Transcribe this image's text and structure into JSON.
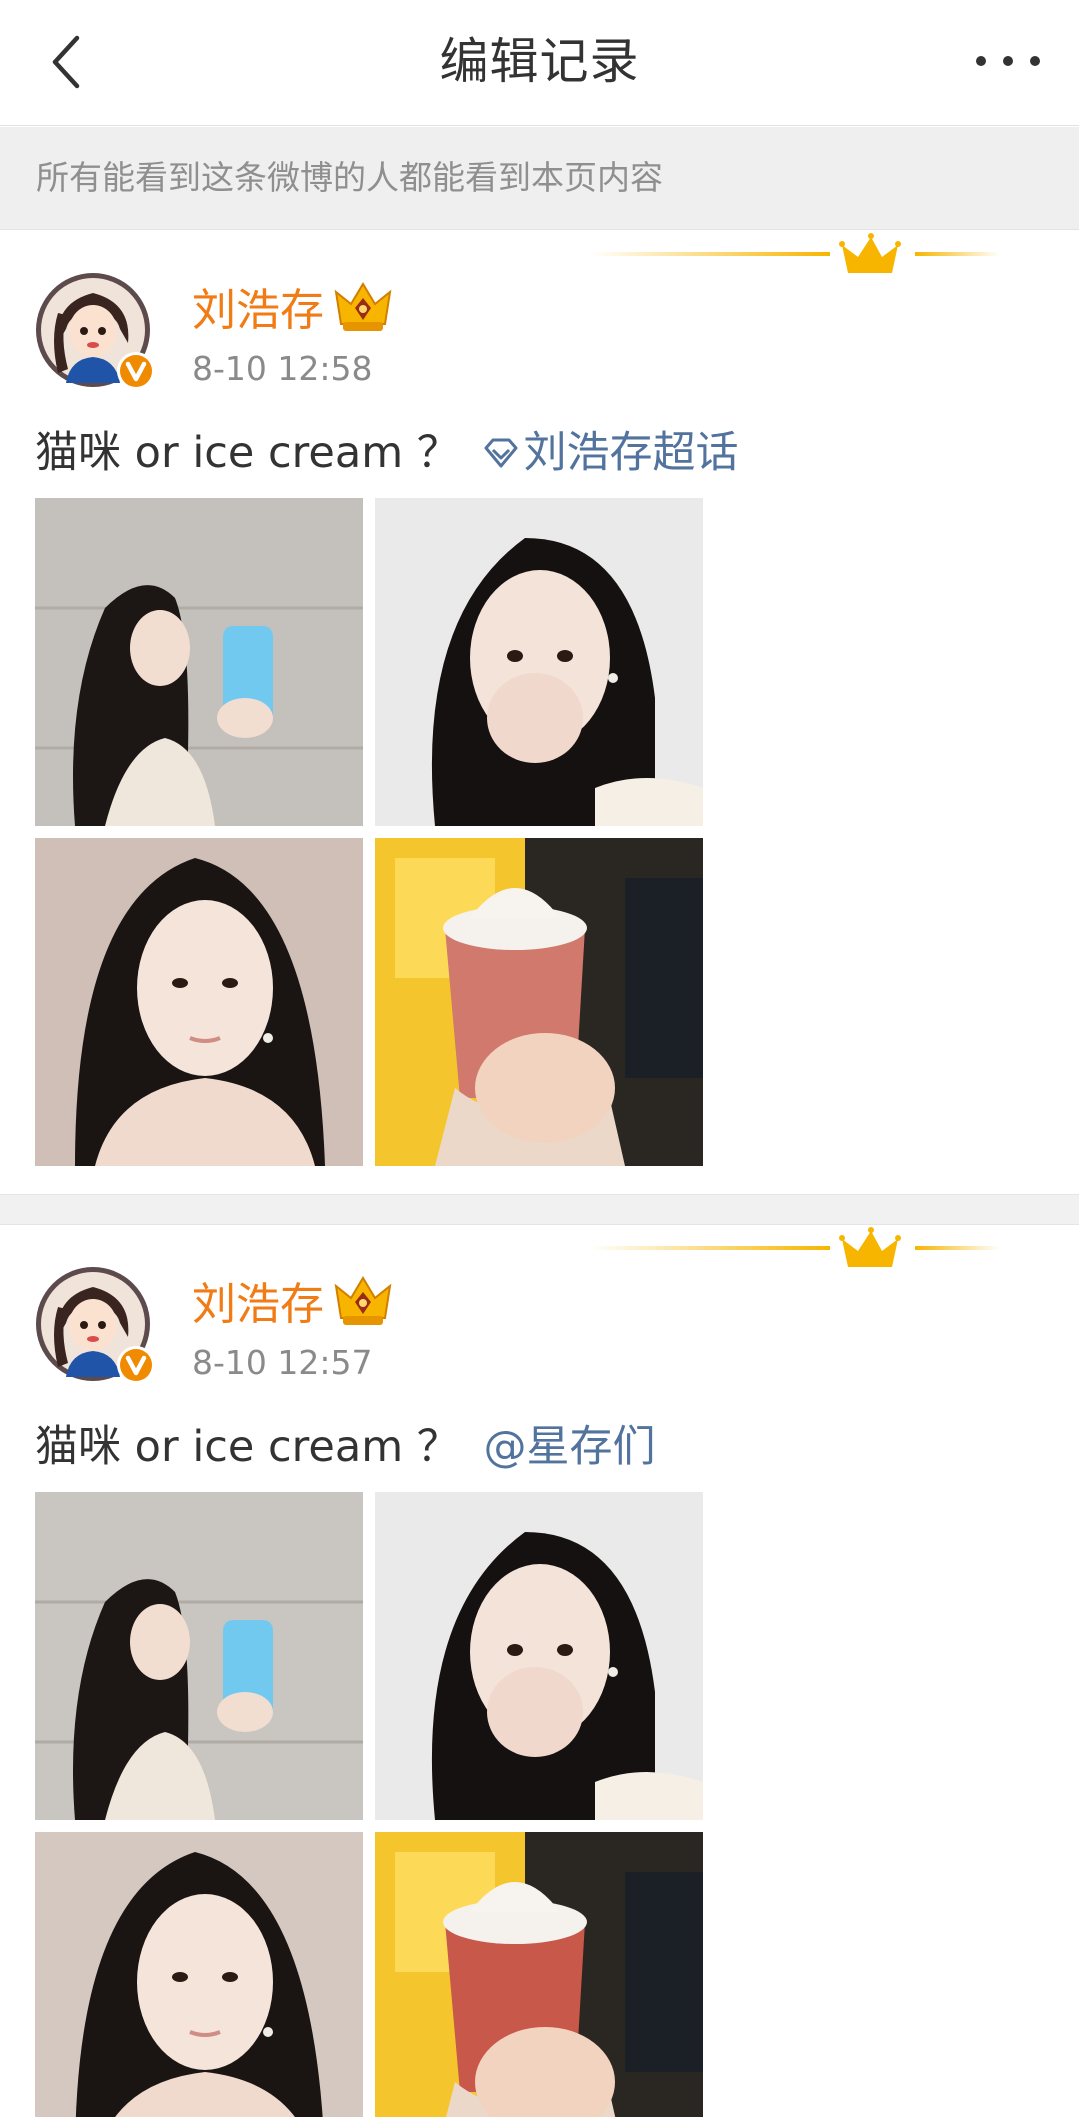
{
  "header": {
    "title": "编辑记录",
    "back_icon": "chevron-left-icon",
    "more_icon": "more-dots-icon"
  },
  "notice": {
    "text": "所有能看到这条微博的人都能看到本页内容"
  },
  "colors": {
    "username": "#f17b14",
    "link": "#52739e",
    "verified": "#f08a00",
    "crown": "#f7b500"
  },
  "posts": [
    {
      "username": "刘浩存",
      "time": "8-10 12:58",
      "text": "猫咪 or ice cream ？",
      "link_text": "刘浩存超话",
      "link_icon": "super-topic-diamond-icon",
      "photos": [
        "selfie-phone-photo",
        "hand-on-cheek-photo",
        "portrait-photo",
        "ice-cream-cup-photo"
      ]
    },
    {
      "username": "刘浩存",
      "time": "8-10 12:57",
      "text": "猫咪 or ice cream ？",
      "link_text": "@星存们",
      "photos": [
        "selfie-phone-photo",
        "hand-on-cheek-photo",
        "portrait-photo",
        "ice-cream-cup-photo"
      ]
    }
  ]
}
